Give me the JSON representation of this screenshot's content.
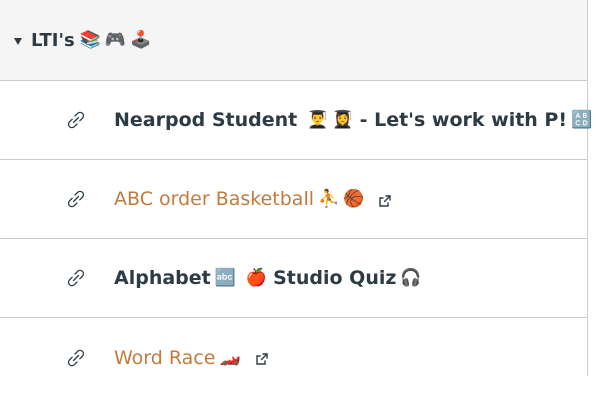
{
  "module": {
    "title": "LTI's",
    "title_emojis": [
      "📚",
      "🎮",
      "🕹️"
    ],
    "items": [
      {
        "prefix": "Nearpod Student",
        "emojis": [
          "👨‍🎓",
          "👩‍🎓"
        ],
        "suffix": "- Let's work with P!",
        "badge": "🔠",
        "style": "bold",
        "external": false
      },
      {
        "prefix": "ABC order Basketball",
        "emojis": [
          "⛹️",
          "🏀"
        ],
        "suffix": "",
        "badge": "",
        "style": "link",
        "external": true
      },
      {
        "prefix": "Alphabet",
        "emojis": [
          "🔤",
          "🍎"
        ],
        "suffix": "Studio Quiz",
        "badge": "🎧",
        "style": "bold",
        "external": false
      },
      {
        "prefix": "Word Race",
        "emojis": [
          "🏎️"
        ],
        "suffix": "",
        "badge": "",
        "style": "link",
        "external": true
      }
    ]
  },
  "icons": {
    "collapse": "caret-down-icon",
    "item": "link-icon",
    "external": "external-link-icon"
  },
  "colors": {
    "header_bg": "#f5f5f5",
    "border": "#c7cdd1",
    "text": "#2d3b45",
    "link": "#c47a3c"
  }
}
